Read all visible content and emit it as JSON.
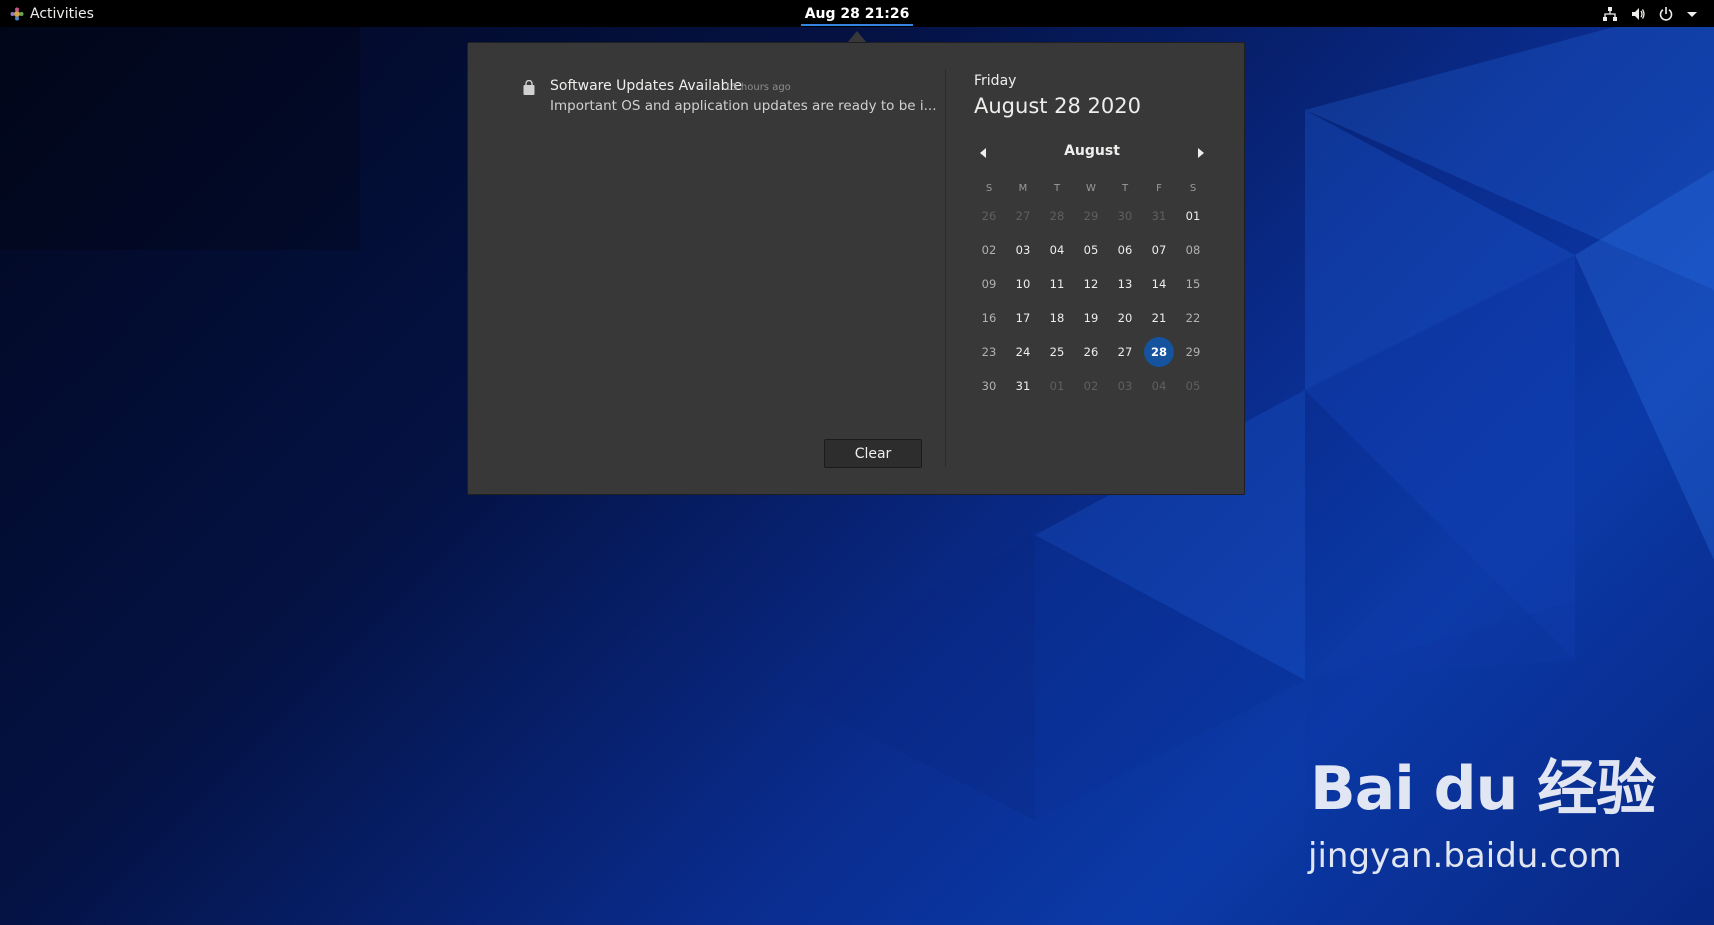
{
  "topbar": {
    "activities_label": "Activities",
    "clock": "Aug 28  21:26",
    "tray_icons": [
      "network-icon",
      "volume-icon",
      "power-icon",
      "menu-arrow-icon"
    ]
  },
  "notifications": {
    "items": [
      {
        "icon": "software-bag-icon",
        "title": "Software Updates Available",
        "time": "15 hours ago",
        "body": "Important OS and application updates are ready to be i..."
      }
    ],
    "clear_label": "Clear"
  },
  "calendar": {
    "weekday": "Friday",
    "full_date": "August 28 2020",
    "month": "August",
    "day_headers": [
      "S",
      "M",
      "T",
      "W",
      "T",
      "F",
      "S"
    ],
    "weeks": [
      [
        "26",
        "27",
        "28",
        "29",
        "30",
        "31",
        "01"
      ],
      [
        "02",
        "03",
        "04",
        "05",
        "06",
        "07",
        "08"
      ],
      [
        "09",
        "10",
        "11",
        "12",
        "13",
        "14",
        "15"
      ],
      [
        "16",
        "17",
        "18",
        "19",
        "20",
        "21",
        "22"
      ],
      [
        "23",
        "24",
        "25",
        "26",
        "27",
        "28",
        "29"
      ],
      [
        "30",
        "31",
        "01",
        "02",
        "03",
        "04",
        "05"
      ]
    ],
    "today": "28"
  },
  "watermark": {
    "logo": "Bai du 经验",
    "url": "jingyan.baidu.com"
  },
  "colors": {
    "topbar": "#000000",
    "popover": "#383838",
    "accent": "#15539e",
    "clock_underline": "#3584e4"
  }
}
